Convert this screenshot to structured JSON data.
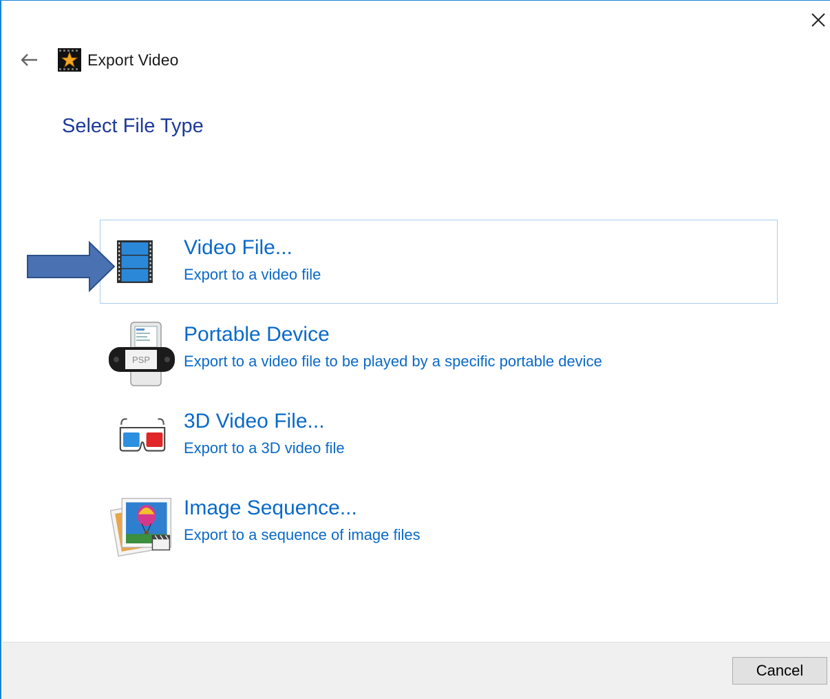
{
  "window": {
    "title": "Export Video",
    "close_icon": "close-icon",
    "back_icon": "back-arrow-icon",
    "app_icon": "videopad-star-icon"
  },
  "page": {
    "title": "Select File Type"
  },
  "options": [
    {
      "title": "Video File...",
      "description": "Export to a video file",
      "icon": "film-strip-icon",
      "selected": true
    },
    {
      "title": "Portable Device",
      "description": "Export to a video file to be played by a specific portable device",
      "icon": "psp-device-icon",
      "icon_label": "PSP",
      "selected": false
    },
    {
      "title": "3D Video File...",
      "description": "Export to a 3D video file",
      "icon": "3d-glasses-icon",
      "selected": false
    },
    {
      "title": "Image Sequence...",
      "description": "Export to a sequence of image files",
      "icon": "image-sequence-icon",
      "selected": false
    }
  ],
  "footer": {
    "cancel_label": "Cancel"
  },
  "colors": {
    "accent": "#0a69c8",
    "heading": "#1e3a9a",
    "selection_border": "#a7cdef",
    "window_border": "#1883d7",
    "pointer_arrow": "#4a72b2"
  }
}
